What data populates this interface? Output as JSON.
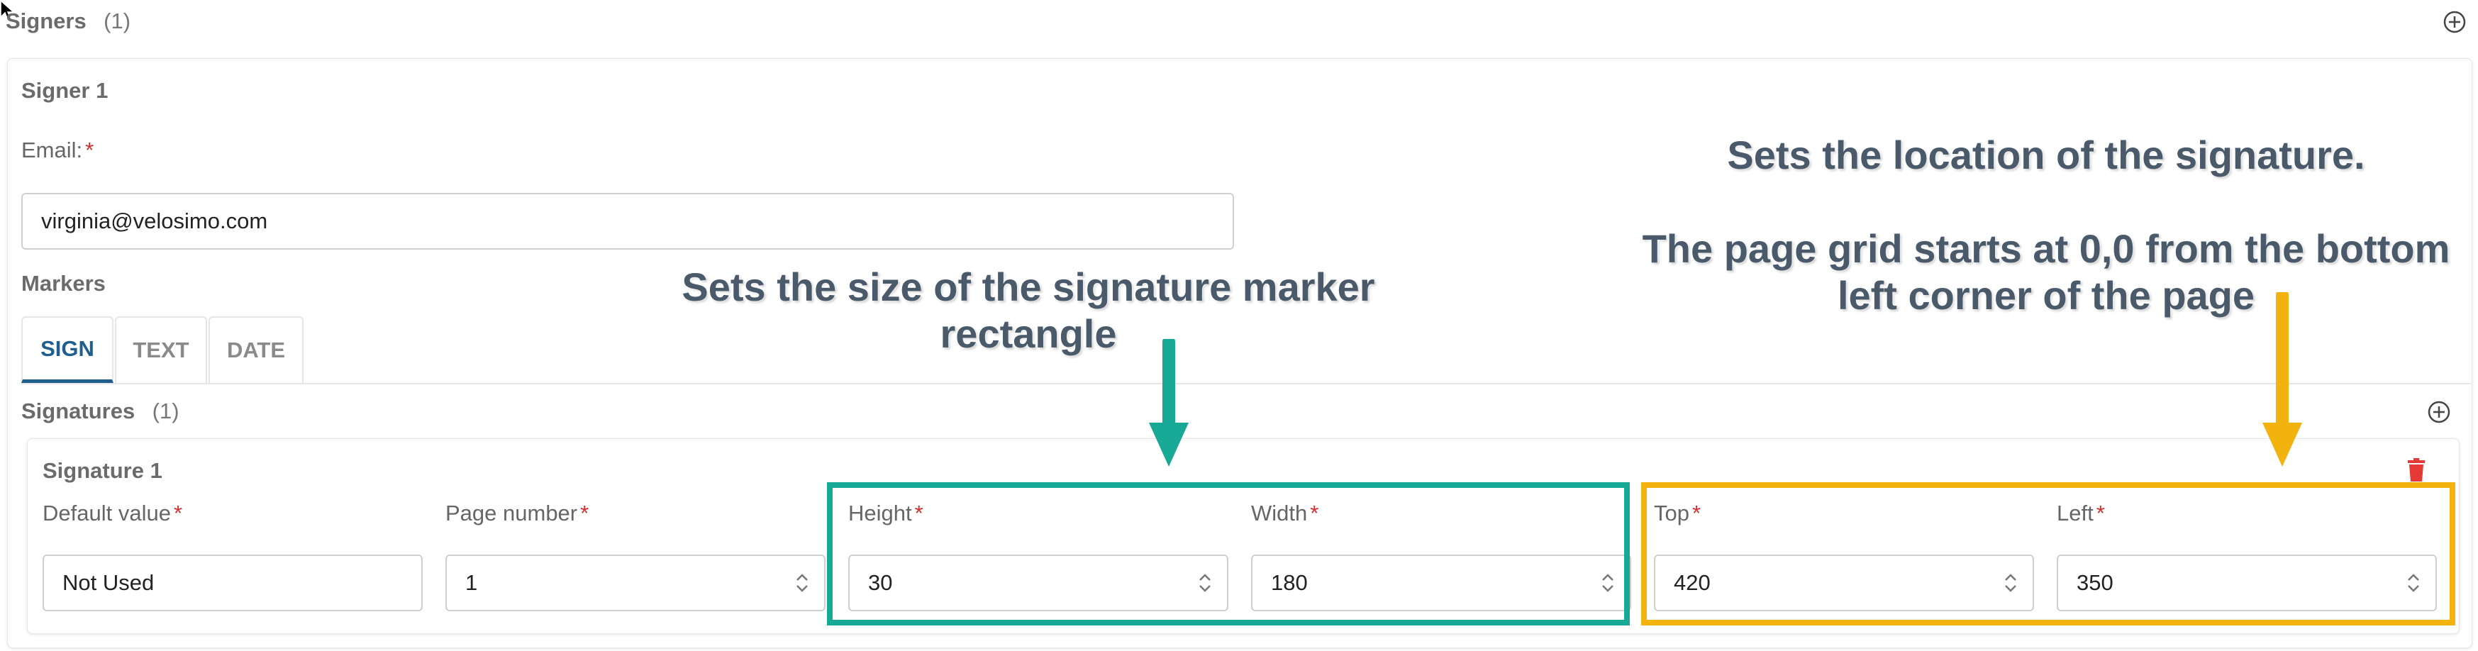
{
  "signers": {
    "title": "Signers",
    "count": "(1)"
  },
  "signer": {
    "title": "Signer 1",
    "email_label": "Email:",
    "email_value": "virginia@velosimo.com",
    "markers_label": "Markers",
    "tabs": [
      {
        "label": "SIGN"
      },
      {
        "label": "TEXT"
      },
      {
        "label": "DATE"
      }
    ]
  },
  "signatures": {
    "title": "Signatures",
    "count": "(1)"
  },
  "signature": {
    "title": "Signature 1",
    "fields": {
      "default_value": {
        "label": "Default value",
        "value": "Not Used"
      },
      "page_number": {
        "label": "Page number",
        "value": "1"
      },
      "height": {
        "label": "Height",
        "value": "30"
      },
      "width": {
        "label": "Width",
        "value": "180"
      },
      "top": {
        "label": "Top",
        "value": "420"
      },
      "left": {
        "label": "Left",
        "value": "350"
      }
    }
  },
  "required_marker": "*",
  "annotations": {
    "size_line1": "Sets the size of the signature marker",
    "size_line2": "rectangle",
    "location_line1": "Sets the location of the signature.",
    "location_line2": "The page grid starts at 0,0 from the bottom",
    "location_line3": "left corner of the page"
  },
  "colors": {
    "accent": "#1f5f8f",
    "required": "#d32f2f",
    "delete": "#e53935",
    "annotation_green": "#17a896",
    "annotation_yellow": "#f2b30e"
  },
  "icons": [
    "cursor-icon",
    "add-circle-icon",
    "trash-icon",
    "spinner-icon",
    "arrow-down-icon"
  ]
}
